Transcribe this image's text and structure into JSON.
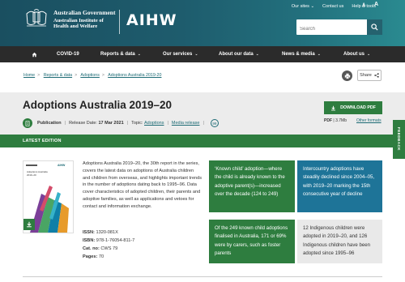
{
  "header": {
    "gov_line1": "Australian Government",
    "gov_line2": "Australian Institute of",
    "gov_line3": "Health and Welfare",
    "logo_text": "AIHW",
    "top_links": [
      "Our sites",
      "Contact us",
      "Help & tools"
    ],
    "font_decrease": "A",
    "font_increase": "A",
    "search_placeholder": "Search"
  },
  "nav": {
    "items": [
      "COVID-19",
      "Reports & data",
      "Our services",
      "About our data",
      "News & media",
      "About us"
    ]
  },
  "breadcrumb": [
    "Home",
    "Reports & data",
    "Adoptions",
    "Adoptions Australia 2019-20"
  ],
  "share_label": "Share",
  "title": "Adoptions Australia 2019–20",
  "meta": {
    "type": "Publication",
    "release_label": "Release Date:",
    "release_date": "17 Mar 2021",
    "topic_label": "Topic:",
    "topic": "Adoptions",
    "media": "Media release",
    "badge": "99"
  },
  "download": {
    "label": "DOWNLOAD PDF",
    "format": "PDF",
    "size": "3.7Mb",
    "other_formats": "Other formats"
  },
  "latest_edition": "LATEST EDITION",
  "feedback": "FEEDBACK",
  "cover": {
    "title": "Adoptions Australia",
    "year": "2019–20",
    "logo": "AIHW"
  },
  "summary": "Adoptions Australia 2019–20, the 30th report in the series, covers the latest data on adoptions of Australia children and children from overseas, and highlights important trends in the number of adoptions dating back to 1995–96. Data cover characteristics of adopted children, their parents and adoptive families, as well as applications and vetoes for contact and information exchange.",
  "facts": [
    {
      "label": "ISSN:",
      "value": "1320-081X"
    },
    {
      "label": "ISBN:",
      "value": "978-1-76054-811-7"
    },
    {
      "label": "Cat. no:",
      "value": "CWS 79"
    },
    {
      "label": "Pages:",
      "value": "70"
    }
  ],
  "tiles": [
    "‘Known child’ adoption—where the child is already known to the adoptive parent(s)—increased over the decade (124 to 249)",
    "Intercountry adoptions have steadily declined since 2004–05, with 2019–20 marking the 15th consecutive year of decline",
    "Of the 249 known child adoptions finalised in Australia, 171 or 69% were by carers, such as foster parents",
    "12 Indigenous children were adopted in 2019–20, and 126 Indigenous children have been adopted since 1995–96"
  ],
  "colors": {
    "header_start": "#1a4f60",
    "header_end": "#2a8a90",
    "nav": "#2b2b2b",
    "green": "#2e7d3f",
    "blue": "#1e7498",
    "grey": "#e9e9e9"
  }
}
